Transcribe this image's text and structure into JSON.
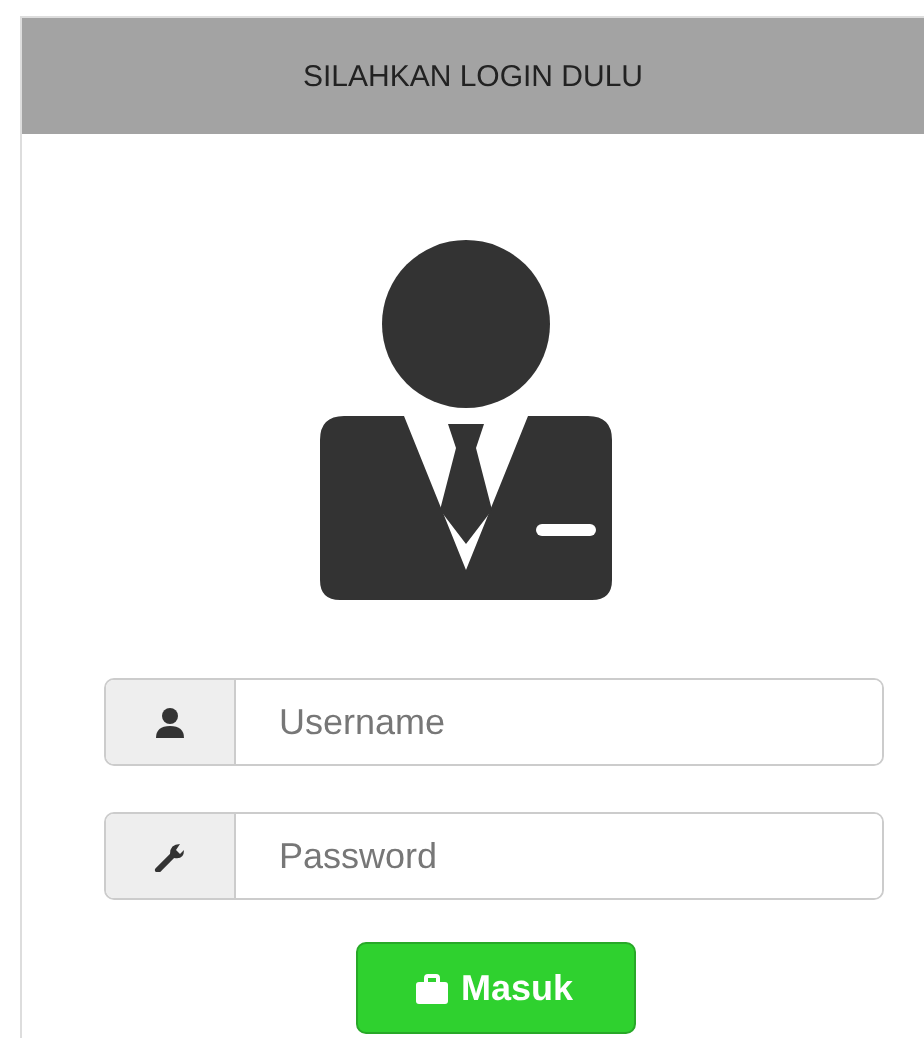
{
  "header": {
    "title": "SILAHKAN LOGIN DULU"
  },
  "fields": [
    {
      "kind": "user",
      "placeholder": "Username"
    },
    {
      "kind": "key",
      "placeholder": "Password"
    }
  ],
  "submit": {
    "label": "Masuk"
  }
}
